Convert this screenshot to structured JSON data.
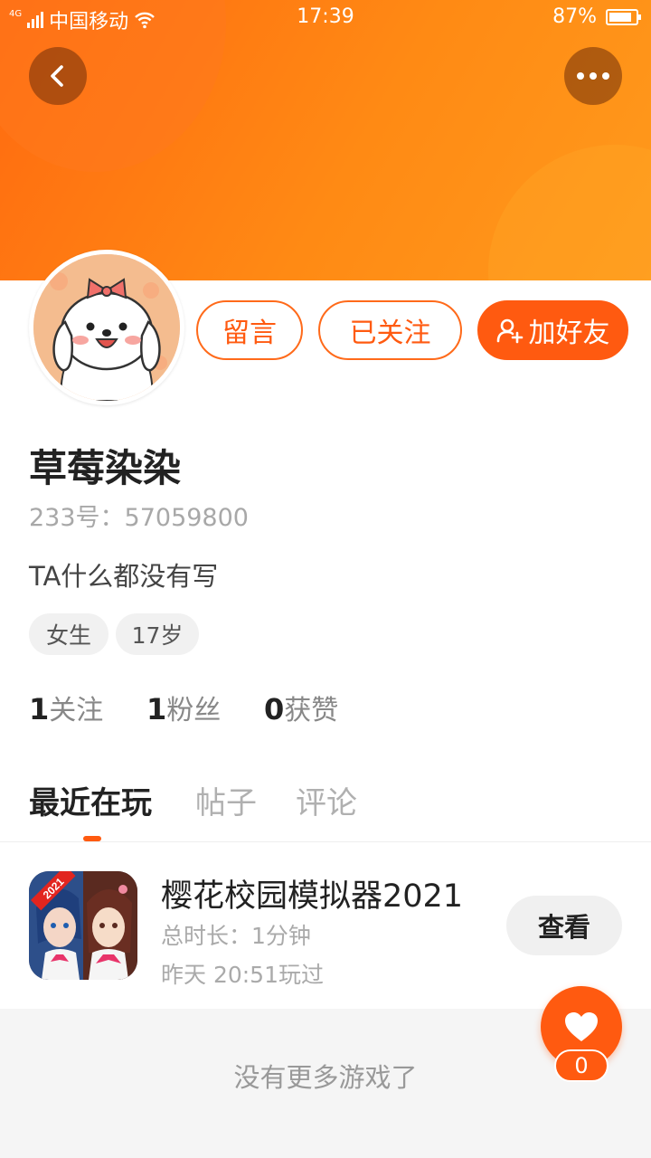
{
  "status_bar": {
    "network": "4G",
    "carrier": "中国移动",
    "time": "17:39",
    "battery": "87%",
    "battery_level": 0.87
  },
  "header": {
    "back_icon": "chevron-left-icon",
    "more_icon": "more-dots-icon"
  },
  "profile": {
    "name": "草莓染染",
    "uid": "233号：57059800",
    "bio": "TA什么都没有写",
    "tags": [
      "女生",
      "17岁"
    ],
    "actions": {
      "message": "留言",
      "following": "已关注",
      "add_friend": "加好友"
    },
    "stats": [
      {
        "count": "1",
        "label": "关注"
      },
      {
        "count": "1",
        "label": "粉丝"
      },
      {
        "count": "0",
        "label": "获赞"
      }
    ]
  },
  "tabs": [
    "最近在玩",
    "帖子",
    "评论"
  ],
  "active_tab": "最近在玩",
  "games": [
    {
      "title": "樱花校园模拟器2021",
      "duration": "总时长：1分钟",
      "last_played": "昨天 20:51玩过",
      "badge": "2021",
      "action": "查看"
    }
  ],
  "footer": "没有更多游戏了",
  "like": {
    "count": "0",
    "icon": "heart-icon"
  },
  "colors": {
    "accent": "#ff5a10",
    "banner_start": "#ff6a10",
    "banner_end": "#ff9a1c"
  }
}
